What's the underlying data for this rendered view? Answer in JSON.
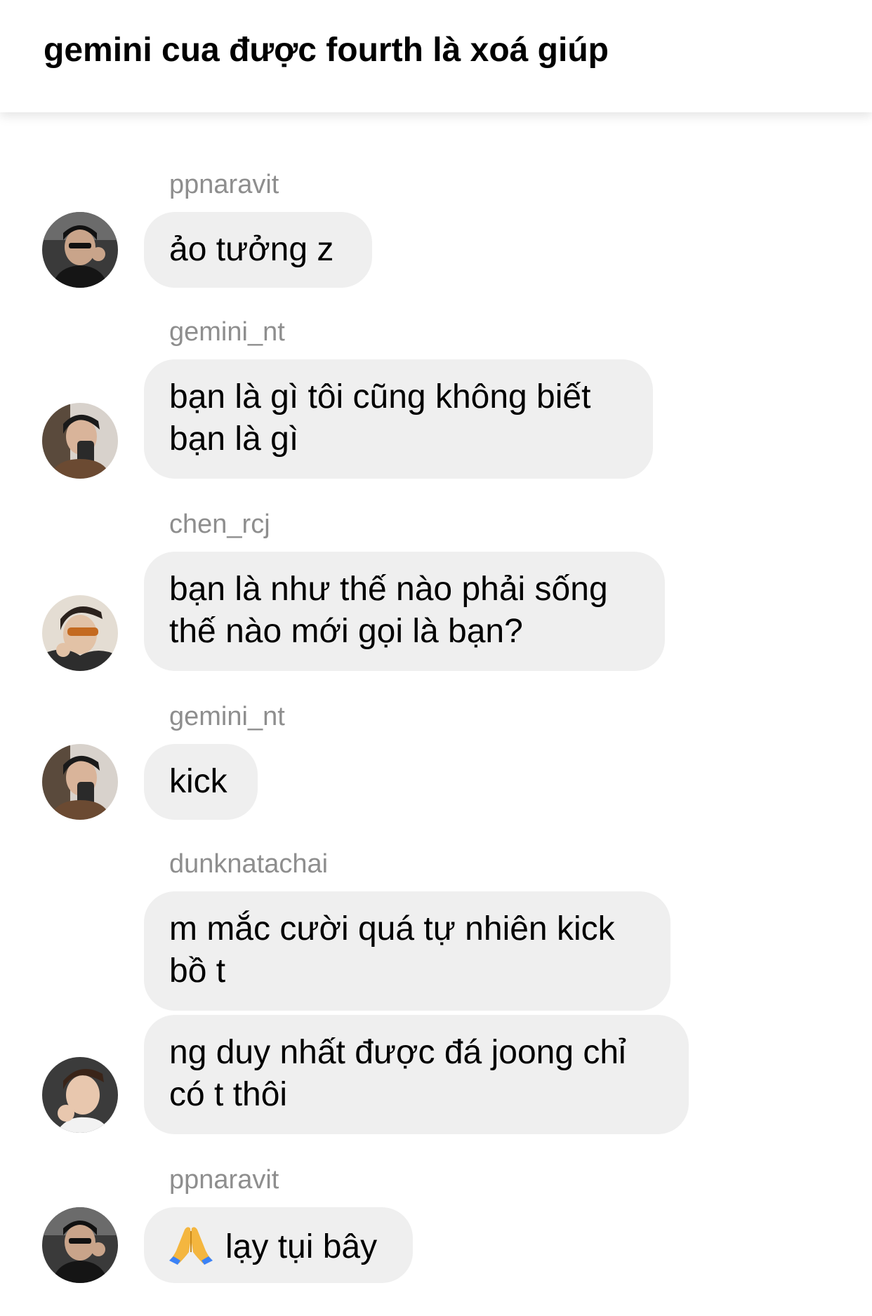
{
  "header": {
    "title": "gemini cua được fourth là xoá giúp"
  },
  "messages": [
    {
      "sender": "ppnaravit",
      "text": "ảo tưởng z"
    },
    {
      "sender": "gemini_nt",
      "text": "bạn là gì tôi cũng không biết\nbạn là gì"
    },
    {
      "sender": "chen_rcj",
      "text": "bạn là như thế nào phải sống\nthế nào mới gọi là bạn?"
    },
    {
      "sender": "gemini_nt",
      "text": "kick"
    },
    {
      "sender": "dunknatachai",
      "text": "m mắc cười quá tự nhiên kick\nbồ t"
    },
    {
      "sender": "",
      "text": "ng duy nhất được đá joong chỉ\ncó t thôi"
    },
    {
      "sender": "ppnaravit",
      "text": "lạy tụi bây",
      "emoji": "folded-hands-icon"
    }
  ],
  "colors": {
    "bubble": "#efefef",
    "sender": "#8e8e8e",
    "background": "#ffffff"
  }
}
